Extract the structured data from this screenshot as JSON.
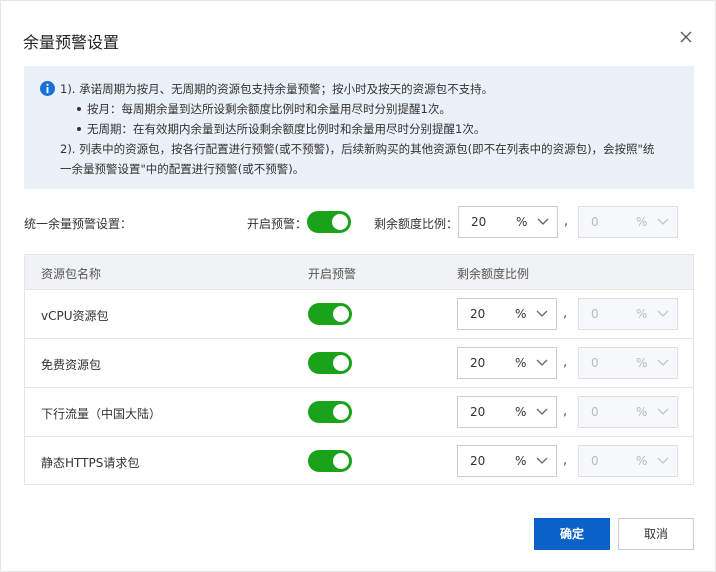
{
  "dialog": {
    "title": "余量预警设置",
    "close_icon": "close-icon"
  },
  "info": {
    "icon": "info-icon",
    "line1": "1). 承诺周期为按月、无周期的资源包支持余量预警；按小时及按天的资源包不支持。",
    "bullet1": "按月：每周期余量到达所设剩余额度比例时和余量用尽时分别提醒1次。",
    "bullet2": "无周期：在有效期内余量到达所设剩余额度比例时和余量用尽时分别提醒1次。",
    "line2a": "2). 列表中的资源包，按各行配置进行预警(或不预警)，后续新购买的其他资源包(即不在列表中的资源包)，会按照\"统",
    "line2b": "一余量预警设置\"中的配置进行预警(或不预警)。"
  },
  "unified": {
    "label": "统一余量预警设置：",
    "enable_label": "开启预警：",
    "enabled": true,
    "ratio_label": "剩余额度比例：",
    "ratio1": {
      "value": "20",
      "unit": "%"
    },
    "ratio2": {
      "value": "0",
      "unit": "%"
    }
  },
  "table": {
    "headers": [
      "资源包名称",
      "开启预警",
      "剩余额度比例"
    ],
    "rows": [
      {
        "name": "vCPU资源包",
        "enabled": true,
        "ratio1": "20",
        "ratio2": "0",
        "unit": "%"
      },
      {
        "name": "免费资源包",
        "enabled": true,
        "ratio1": "20",
        "ratio2": "0",
        "unit": "%"
      },
      {
        "name": "下行流量（中国大陆）",
        "enabled": true,
        "ratio1": "20",
        "ratio2": "0",
        "unit": "%"
      },
      {
        "name": "静态HTTPS请求包",
        "enabled": true,
        "ratio1": "20",
        "ratio2": "0",
        "unit": "%"
      }
    ]
  },
  "footer": {
    "confirm_label": "确定",
    "cancel_label": "取消"
  },
  "colors": {
    "primary": "#0a62c8",
    "toggle_on": "#1aa31a",
    "info_bg": "#ebf1f8",
    "info_icon": "#1a6fd4"
  }
}
